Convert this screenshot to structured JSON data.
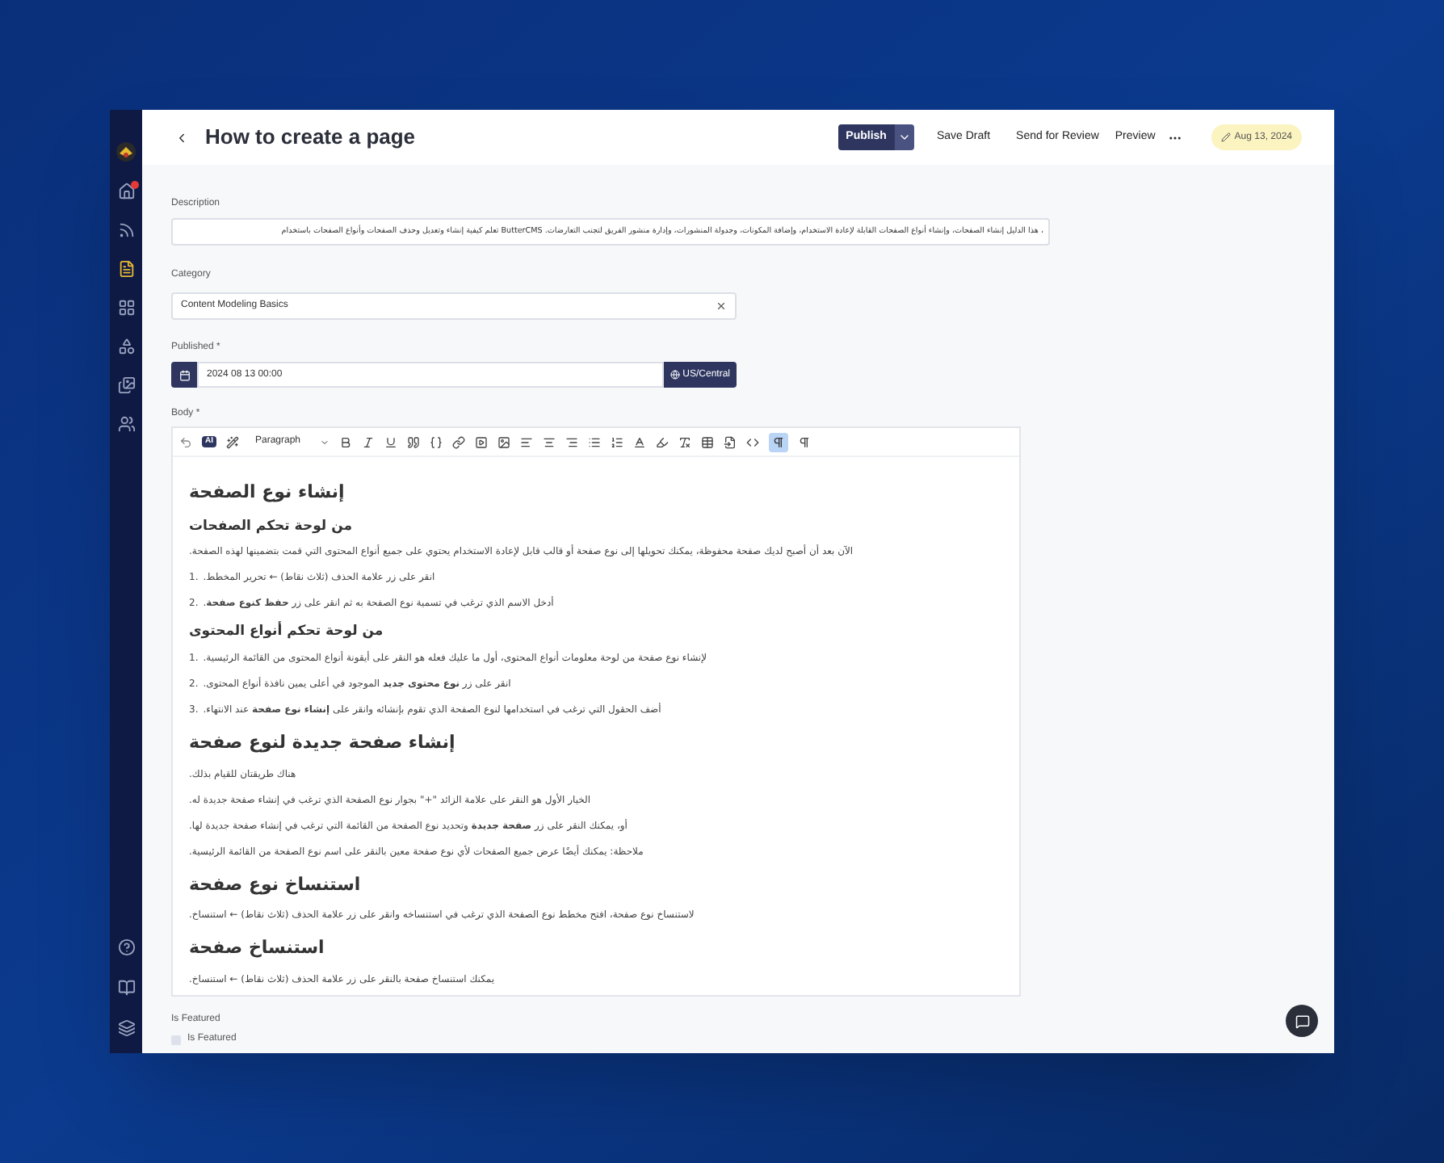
{
  "sidebar": {
    "items": [
      {
        "kind": "home",
        "selected": false,
        "notification": true
      },
      {
        "kind": "blog",
        "selected": false,
        "notification": false
      },
      {
        "kind": "pages",
        "selected": true,
        "notification": false
      },
      {
        "kind": "collections",
        "selected": false,
        "notification": false
      },
      {
        "kind": "content-types",
        "selected": false,
        "notification": false
      },
      {
        "kind": "media",
        "selected": false,
        "notification": false
      },
      {
        "kind": "users",
        "selected": false,
        "notification": false
      }
    ],
    "bottom_items": [
      {
        "kind": "help"
      },
      {
        "kind": "docs"
      },
      {
        "kind": "layers"
      }
    ]
  },
  "header": {
    "title": "How to create a page",
    "publish": "Publish",
    "save_draft": "Save Draft",
    "send_for_review": "Send for Review",
    "preview": "Preview",
    "date": "Aug 13, 2024"
  },
  "fields": {
    "description": {
      "label": "Description",
      "value": "، هذا الدليل إنشاء الصفحات، وإنشاء أنواع الصفحات القابلة لإعادة الاستخدام، وإضافة المكونات، وجدولة المنشورات، وإدارة منشور الفريق لتجنب التعارضات. ButterCMS تعلم كيفية إنشاء وتعديل وحذف الصفحات وأنواع الصفحات باستخدام"
    },
    "category": {
      "label": "Category",
      "value": "Content Modeling Basics"
    },
    "published": {
      "label": "Published *",
      "value": "2024 08 13 00:00",
      "timezone": "US/Central"
    },
    "body": {
      "label": "Body *"
    }
  },
  "toolbar": {
    "ai": "AI",
    "block_format": "Paragraph",
    "direction_selected": true
  },
  "body": [
    {
      "kind": "h2",
      "text": "إنشاء نوع الصفحة"
    },
    {
      "kind": "h3",
      "text": "من لوحة تحكم الصفحات"
    },
    {
      "kind": "p",
      "text": "الآن بعد أن أصبح لديك صفحة محفوظة، يمكنك تحويلها إلى نوع صفحة أو قالب قابل لإعادة الاستخدام يحتوي على جميع أنواع المحتوى التي قمت بتضمينها لهذه الصفحة."
    },
    {
      "kind": "li",
      "number": "1.",
      "text": "انقر على زر علامة الحذف (ثلاث نقاط) ← تحرير المخطط."
    },
    {
      "kind": "li",
      "number": "2.",
      "text": "أدخل الاسم الذي ترغب في تسمية نوع الصفحة به ثم انقر على زر **حفظ كنوع صفحة**."
    },
    {
      "kind": "h3",
      "text": "من لوحة تحكم أنواع المحتوى"
    },
    {
      "kind": "li",
      "number": "1.",
      "text": "لإنشاء نوع صفحة من لوحة معلومات أنواع المحتوى، أول ما عليك فعله هو النقر على أيقونة أنواع المحتوى من القائمة الرئيسية."
    },
    {
      "kind": "li",
      "number": "2.",
      "text": "انقر على زر **نوع محتوى جديد** الموجود في أعلى يمين نافذة أنواع المحتوى."
    },
    {
      "kind": "li",
      "number": "3.",
      "text": "أضف الحقول التي ترغب في استخدامها لنوع الصفحة الذي تقوم بإنشائه وانقر على **إنشاء نوع صفحة** عند الانتهاء."
    },
    {
      "kind": "h2",
      "text": "إنشاء صفحة جديدة لنوع صفحة"
    },
    {
      "kind": "p",
      "text": "هناك طريقتان للقيام بذلك."
    },
    {
      "kind": "p",
      "text": "الخيار الأول هو النقر على علامة الزائد \"+\" بجوار نوع الصفحة الذي ترغب في إنشاء صفحة جديدة له."
    },
    {
      "kind": "p",
      "text": "أو، يمكنك النقر على زر **صفحة جديدة** وتحديد نوع الصفحة من القائمة التي ترغب في إنشاء صفحة جديدة لها."
    },
    {
      "kind": "p",
      "text": "ملاحظة: يمكنك أيضًا عرض جميع الصفحات لأي نوع صفحة معين بالنقر على اسم نوع الصفحة من القائمة الرئيسية."
    },
    {
      "kind": "h2",
      "text": "استنساخ نوع صفحة"
    },
    {
      "kind": "p",
      "text": "لاستنساخ نوع صفحة، افتح مخطط نوع الصفحة الذي ترغب في استنساخه وانقر على زر علامة الحذف (ثلاث نقاط) ← استنساخ."
    },
    {
      "kind": "h2",
      "text": "استنساخ صفحة"
    },
    {
      "kind": "p",
      "text": "يمكنك استنساخ صفحة بالنقر على زر علامة الحذف (ثلاث نقاط) ← استنساخ."
    }
  ],
  "featured": {
    "label": "Is Featured",
    "checkbox_label": "Is Featured",
    "checked": false
  }
}
